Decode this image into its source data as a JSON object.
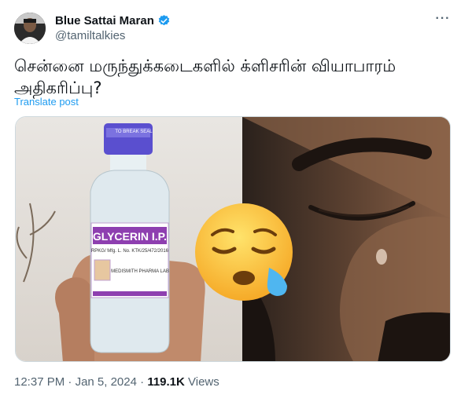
{
  "author": {
    "name": "Blue Sattai Maran",
    "handle": "@tamiltalkies",
    "verified_color": "#1d9bf0"
  },
  "more_label": "···",
  "post": {
    "text": "சென்னை மருந்துக்கடைகளில் க்ளிசரின் வியாபாரம் அதிகரிப்பு?",
    "translate_label": "Translate post"
  },
  "media": {
    "bottle_label": "GLYCERIN I.P.",
    "bottle_sub": "RPKG/ Mfg. L. No. KTK/25/472/2016",
    "bottle_mfr": "MEDISMITH PHARMA LAB",
    "cap_text": "TO BREAK SEAL",
    "emoji": "😪"
  },
  "meta": {
    "time": "12:37 PM",
    "sep": " · ",
    "date": "Jan 5, 2024",
    "sep2": " · ",
    "views_count": "119.1K",
    "views_label": " Views"
  }
}
